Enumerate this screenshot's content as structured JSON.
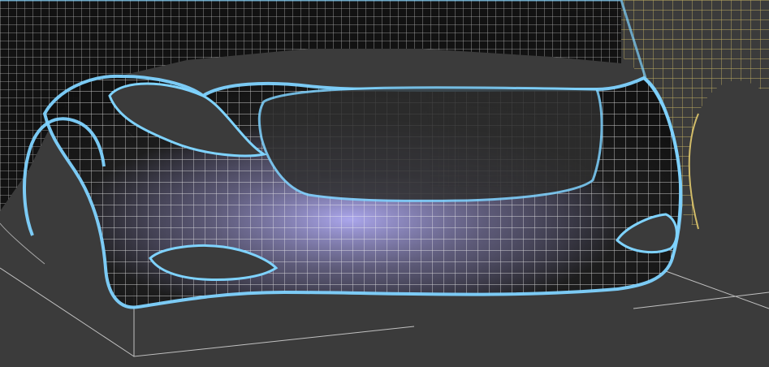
{
  "viewport": {
    "label": "",
    "background_color": "#3b3b3b"
  },
  "colors": {
    "mesh_white": "#f2f2f2",
    "mesh_yellow": "#d9c26a",
    "selection_outline": "#7fd3ff",
    "fill_dark": "#111111",
    "fill_highlight": "#b7b2ff",
    "ground_lines": "#d0d0d0"
  },
  "scene": {
    "description_tags": [
      "wireframe",
      "car-front-bumper",
      "3d-viewport"
    ]
  }
}
